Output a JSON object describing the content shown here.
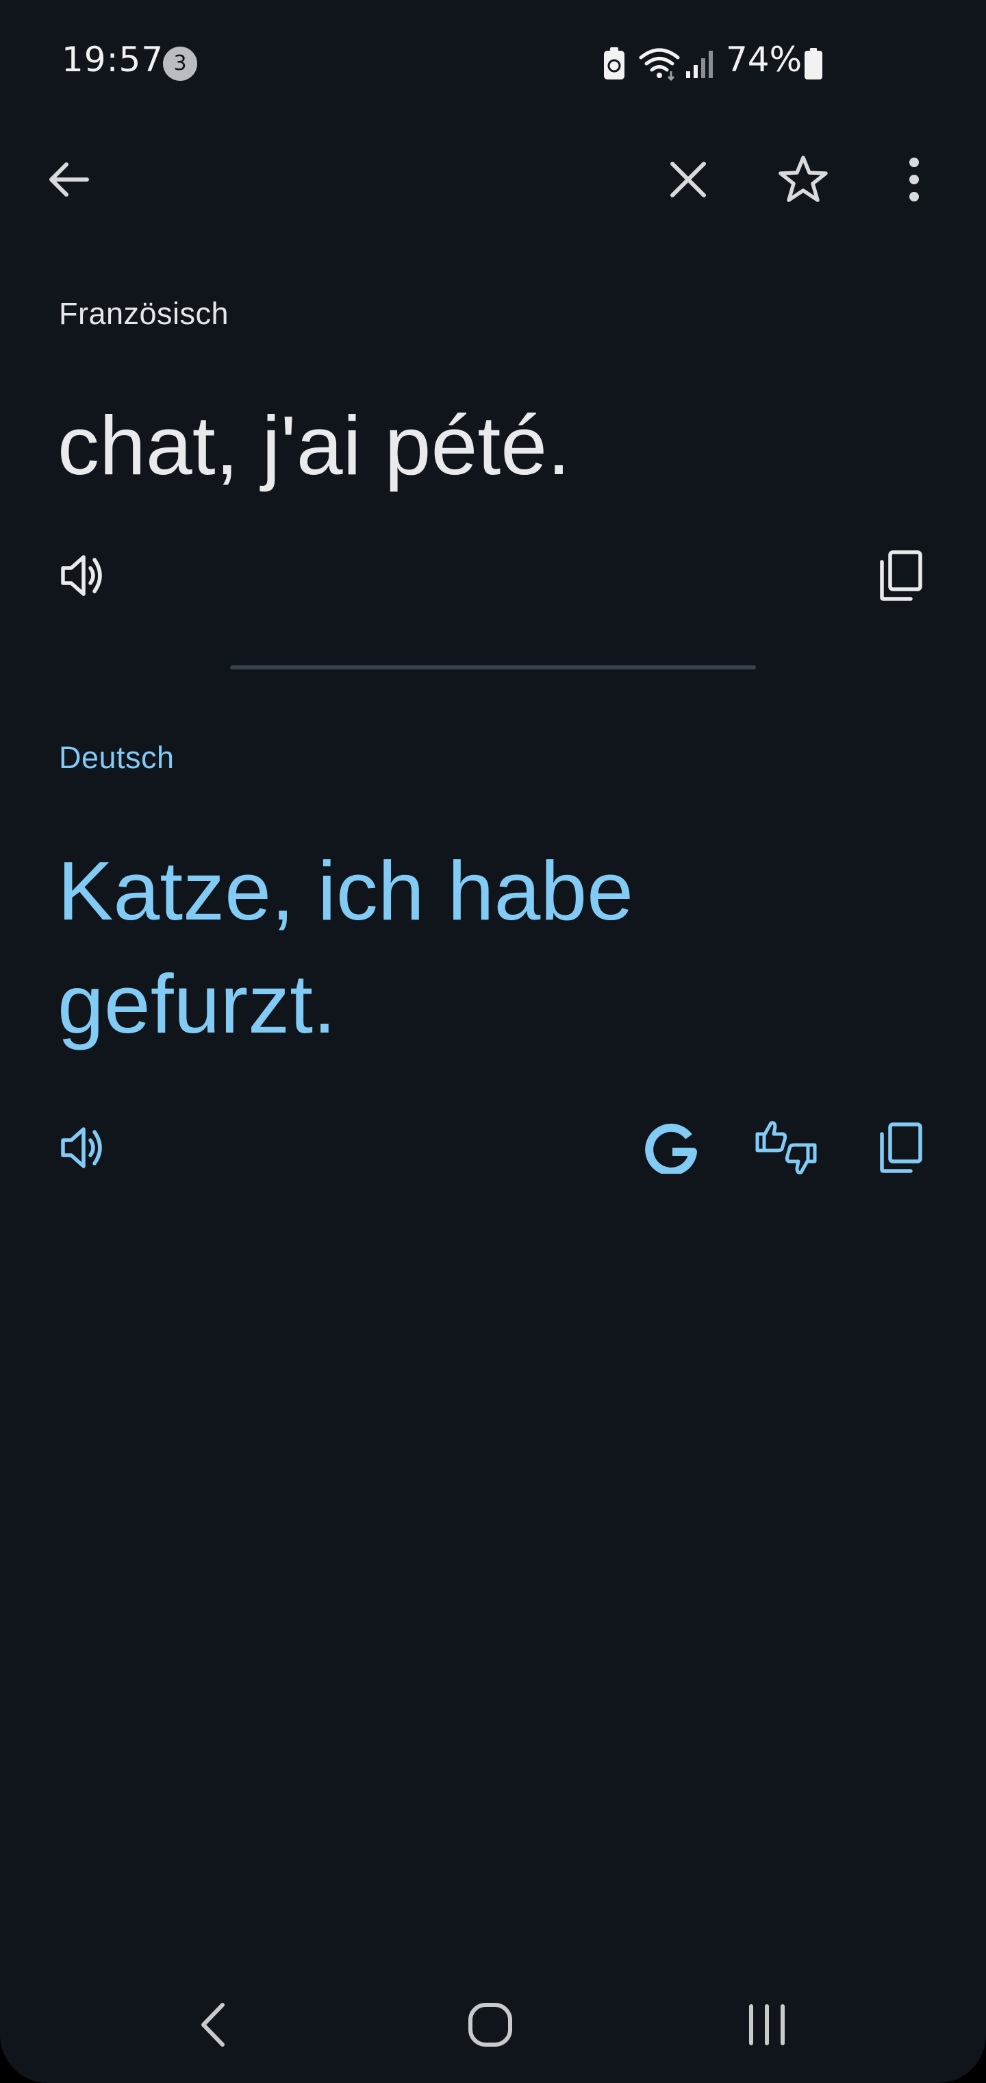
{
  "status_bar": {
    "time": "19:57",
    "notification_count": "3",
    "battery_percent": "74%",
    "icons": [
      "battery-saver-icon",
      "wifi-icon",
      "signal-icon",
      "battery-icon"
    ]
  },
  "toolbar": {
    "icons": [
      "back-arrow-icon",
      "close-icon",
      "star-icon",
      "more-vert-icon"
    ]
  },
  "source": {
    "language": "Französisch",
    "text": "chat, j'ai pété.",
    "icons": [
      "speaker-icon",
      "copy-icon"
    ]
  },
  "target": {
    "language": "Deutsch",
    "text": "Katze, ich habe gefurzt.",
    "icons": [
      "speaker-icon",
      "google-icon",
      "feedback-thumbs-icon",
      "copy-icon"
    ]
  },
  "nav_bar": {
    "icons": [
      "nav-back-icon",
      "nav-home-icon",
      "nav-recents-icon"
    ]
  },
  "colors": {
    "background": "#10141b",
    "accent": "#82cbf5",
    "text_primary": "#e9eaec",
    "divider": "#38434c"
  }
}
